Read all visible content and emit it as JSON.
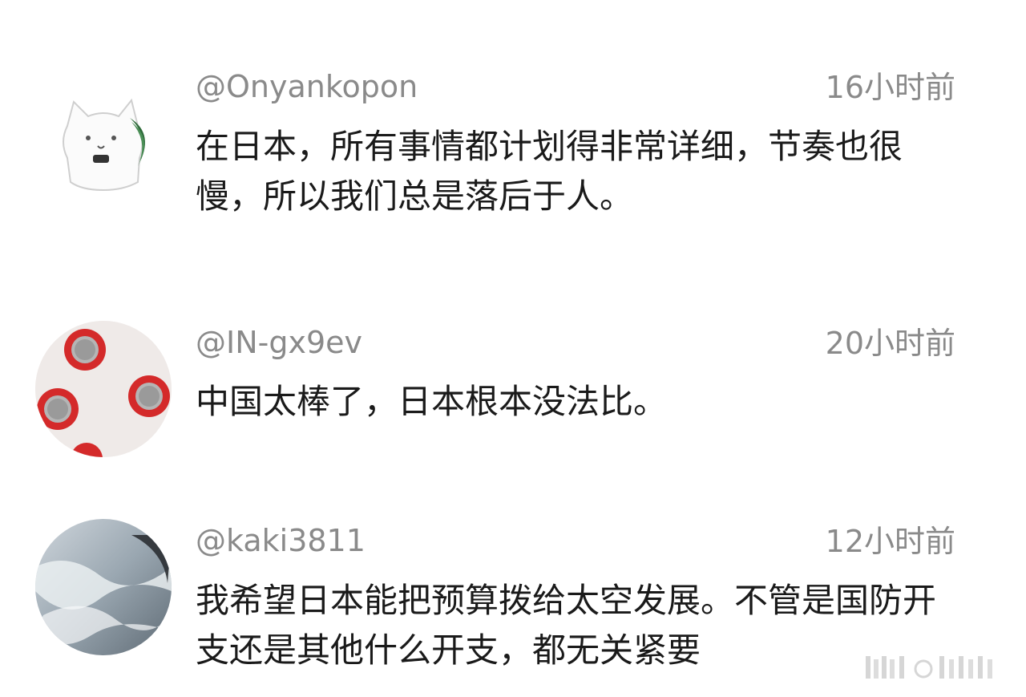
{
  "comments": [
    {
      "username": "@Onyankopon",
      "time": "16小时前",
      "text": "在日本，所有事情都计划得非常详细，节奏也很慢，所以我们总是落后于人。",
      "avatar_icon": "white-cat-avatar-icon"
    },
    {
      "username": "@IN-gx9ev",
      "time": "20小时前",
      "text": "中国太棒了，日本根本没法比。",
      "avatar_icon": "red-chess-pieces-avatar-icon"
    },
    {
      "username": "@kaki3811",
      "time": "12小时前",
      "text": "我希望日本能把预算拨给太空发展。不管是国防开支还是其他什么开支，都无关紧要",
      "avatar_icon": "ocean-wave-avatar-icon"
    }
  ],
  "colors": {
    "meta_gray": "#8a8a8a",
    "text_dark": "#1a1a1a",
    "background": "#ffffff"
  }
}
